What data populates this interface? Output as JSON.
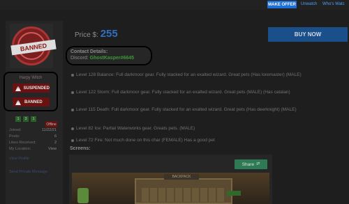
{
  "topbar": {
    "make_offer": "MAKE OFFER",
    "unwatch": "Unwatch",
    "who_watching": "Who's Watc"
  },
  "seller": {
    "avatar_stamp": "BANNED",
    "username": "Harpy Witch",
    "tags": [
      "SUSPENDED",
      "BANNED"
    ],
    "badges": [
      "1",
      "3",
      "1"
    ],
    "status": "Offline",
    "stats": [
      {
        "label": "Joined:",
        "value": "11/22/21"
      },
      {
        "label": "Posts:",
        "value": "6"
      },
      {
        "label": "Likes Received:",
        "value": "2"
      },
      {
        "label": "My Location:",
        "value": "View"
      }
    ],
    "links": [
      "View Profile",
      "Send Private Message"
    ]
  },
  "listing": {
    "price_label": "Price $:",
    "price_value": "255",
    "buy_button": "BUY NOW",
    "contact_title": "Contact Details:",
    "contact_prefix": "Discord:",
    "discord_handle": "GhostKasper#6645",
    "descriptions": [
      "Level 128 Balance: Full darkmoor gear. Fully stacked for an exalted wizard. Great pets (Has loremaster) (MALE)",
      "Level 122 Storm: Full darkmoor gear. Fully stacked for an exalted wizard. Great pets (MALE) (Has catalan)",
      "Level 115 Death: Full darkmoor gear. Fully stacked for an exalted wizard. Great pets (Has deerknight) (MALE)",
      "Level 82 Ice: Partial Waterworks gear. Greats pets. (MALE)",
      "Level 72 Fire: Not much done on this char (FEMALE) Has a good pet"
    ],
    "screens_label": "Screens:",
    "share_button": "Share",
    "screenshot_caption": "BACKPACK"
  },
  "colors": {
    "accent_blue": "#1b6fd6",
    "banned_red": "#6a1111",
    "discord_green": "#3a9a3a",
    "share_green": "#2e7a55"
  },
  "icons": {
    "warning": "warning-triangle-icon",
    "share": "share-icon"
  }
}
